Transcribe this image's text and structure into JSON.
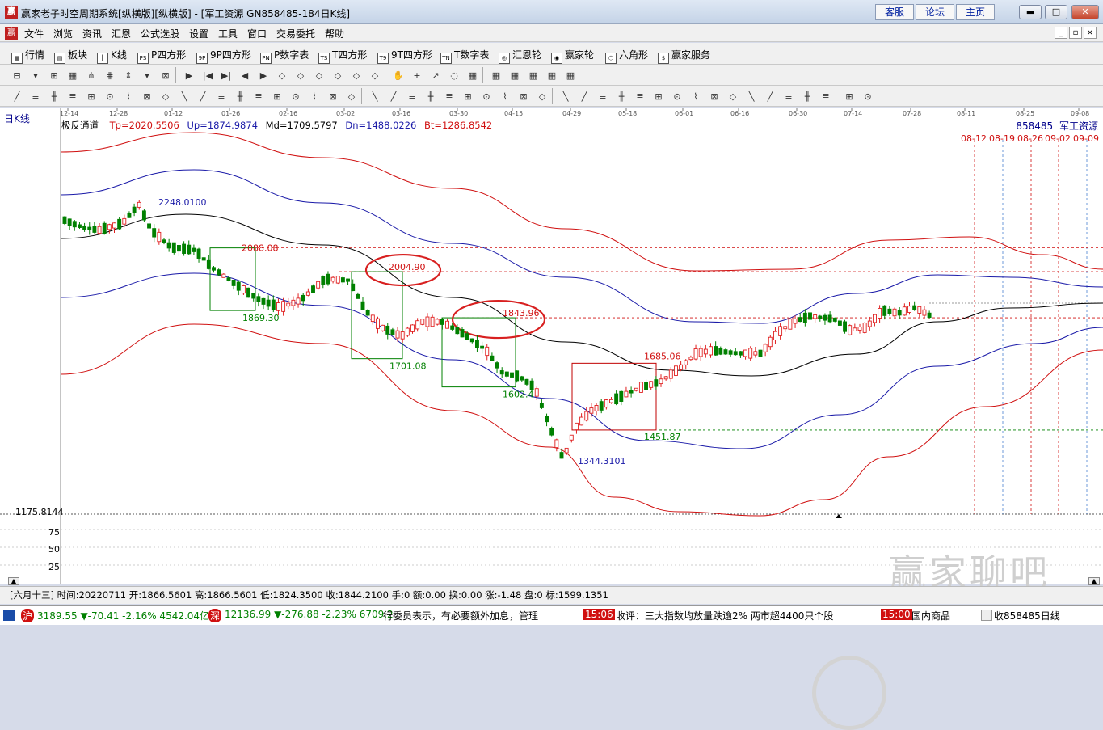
{
  "window": {
    "title": "赢家老子时空周期系统[纵横版][纵横版] - [军工资源  GN858485-184日K线]",
    "logo_text": "赢",
    "nav_buttons": [
      "客服",
      "论坛",
      "主页"
    ],
    "min_label": "▬",
    "max_label": "□",
    "close_label": "✕"
  },
  "menu": {
    "items": [
      "文件",
      "浏览",
      "资讯",
      "汇恩",
      "公式选股",
      "设置",
      "工具",
      "窗口",
      "交易委托",
      "帮助"
    ],
    "mdi_buttons": [
      "_",
      "▫",
      "×"
    ]
  },
  "navbar": {
    "items": [
      {
        "label": "行情",
        "icon": "▦"
      },
      {
        "label": "板块",
        "icon": "▤"
      },
      {
        "label": "K线",
        "icon": "┃"
      },
      {
        "label": "P四方形",
        "icon": "PS"
      },
      {
        "label": "9P四方形",
        "icon": "9P"
      },
      {
        "label": "P数字表",
        "icon": "PN"
      },
      {
        "label": "T四方形",
        "icon": "TS"
      },
      {
        "label": "9T四方形",
        "icon": "T9"
      },
      {
        "label": "T数字表",
        "icon": "TN"
      },
      {
        "label": "汇恩轮",
        "icon": "◎"
      },
      {
        "label": "赢家轮",
        "icon": "◉"
      },
      {
        "label": "六角形",
        "icon": "⬡"
      },
      {
        "label": "赢家服务",
        "icon": "$"
      }
    ]
  },
  "chart": {
    "period_label": "日K线",
    "indicator_name": "极反通道",
    "tp_label": "Tp=2020.5506",
    "up_label": "Up=1874.9874",
    "md_label": "Md=1709.5797",
    "dn_label": "Dn=1488.0226",
    "bt_label": "Bt=1286.8542",
    "code_label": "858485",
    "name_label": "军工资源",
    "price_axis_label": "1175.8144",
    "dates": [
      "12-14",
      "12-28",
      "01-12",
      "01-26",
      "02-16",
      "03-02",
      "03-16",
      "03-30",
      "04-15",
      "04-29",
      "05-18",
      "06-01",
      "06-16",
      "06-30",
      "07-14",
      "07-28",
      "08-11",
      "08-25",
      "09-08"
    ],
    "future_dates": [
      "08-12",
      "08-19",
      "08-26",
      "09-02",
      "09-09"
    ],
    "annotations": {
      "high": "2248.0100",
      "low": "1344.3101",
      "box1_top": "2088.08",
      "box1_bottom": "1869.30",
      "box2_top": "2004.90",
      "box2_bottom": "1701.08",
      "box3_top": "1843.96",
      "box3_bottom": "1602.4",
      "box4_top": "1685.06",
      "box4_bottom": "1451.87"
    },
    "sub_axis_labels": [
      "75",
      "50",
      "25"
    ],
    "colors": {
      "up": "#e02020",
      "down": "#008000",
      "outer_band": "#d01010",
      "inner_band": "#1a1aa8",
      "mid": "#000000",
      "box": "#008000",
      "box4": "#c00000"
    }
  },
  "info": {
    "text": "[六月十三] 时间:20220711 开:1866.5601 高:1866.5601 低:1824.3500 收:1844.2100 手:0 额:0.00 换:0.00 涨:-1.48 盘:0 标:1599.1351"
  },
  "ticker": {
    "sh_label": "沪",
    "sh_value": "3189.55 ▼-70.41 -2.16% 4542.04亿",
    "sz_label": "深",
    "sz_value": "12136.99 ▼-276.88 -2.23% 6709.2",
    "scroll_text": "行委员表示，有必要额外加息，管理",
    "time1": "15:06",
    "news1": "收评：三大指数均放量跌逾2% 两市超4400只个股",
    "time2": "15:00",
    "news2": "国内商品",
    "bottom_right": "收858485日线"
  },
  "watermark": "赢家聊吧"
}
